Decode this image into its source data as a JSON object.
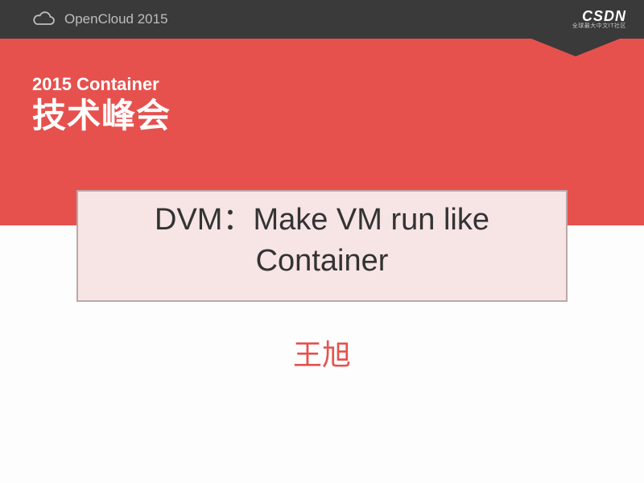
{
  "topbar": {
    "event": "OpenCloud 2015",
    "sponsor": "CSDN",
    "sponsor_tagline": "全球最大中文IT社区"
  },
  "conference": {
    "line1": "2015 Container",
    "line2": "技术峰会"
  },
  "talk": {
    "title": "DVM：Make VM run like Container",
    "author": "王旭"
  },
  "colors": {
    "accent_red": "#e6514e",
    "topbar_dark": "#3a3a3a",
    "title_bg": "#f7e4e4"
  }
}
